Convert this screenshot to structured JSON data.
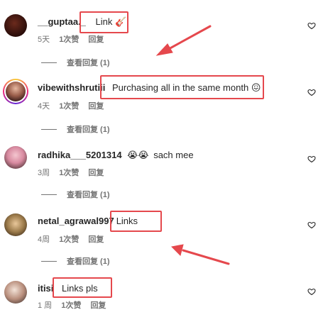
{
  "comments": [
    {
      "username": "__guptaa._",
      "text": "Link",
      "emoji": "🎸",
      "time": "5天",
      "likes": "1次赞",
      "reply": "回复",
      "view_replies": "查看回复 (1)"
    },
    {
      "username": "vibewithshrutiii",
      "text": "Purchasing all in the same month",
      "emoji": "😖",
      "time": "4天",
      "likes": "1次赞",
      "reply": "回复",
      "view_replies": "查看回复 (1)"
    },
    {
      "username": "radhika___5201314",
      "text": "sach mee",
      "emoji": "😭😭",
      "time": "3周",
      "likes": "1次赞",
      "reply": "回复",
      "view_replies": "查看回复 (1)"
    },
    {
      "username": "netal_agrawal997",
      "text": "Links",
      "emoji": "",
      "time": "4周",
      "likes": "1次赞",
      "reply": "回复",
      "view_replies": "查看回复 (1)"
    },
    {
      "username": "itisi",
      "text": "Links pls",
      "emoji": "",
      "time": "1 周",
      "likes": "1次赞",
      "reply": "回复",
      "view_replies": ""
    }
  ],
  "colors": {
    "highlight": "#e5484d",
    "muted": "#737373",
    "text": "#262626"
  },
  "icons": [
    "heart-outline-icon",
    "red-arrow-annotation"
  ]
}
